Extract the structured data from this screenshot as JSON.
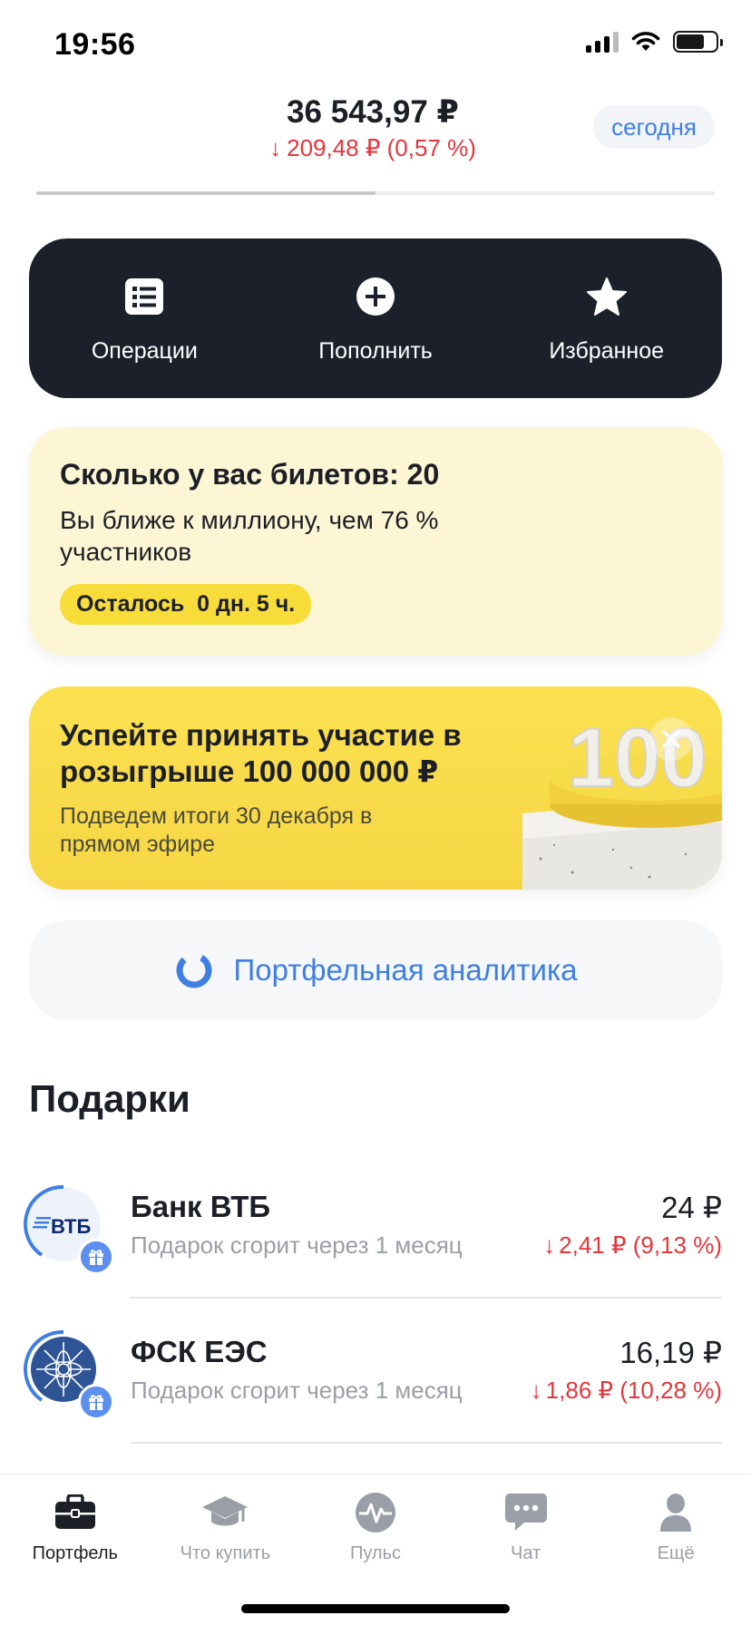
{
  "status_bar": {
    "time": "19:56",
    "battery_level": 0.72
  },
  "header": {
    "balance": "36 543,97 ₽",
    "change_arrow": "↓",
    "change": "209,48 ₽ (0,57 %)",
    "period": "сегодня",
    "progress": 0.5
  },
  "actions": [
    {
      "label": "Операции",
      "icon": "list-icon"
    },
    {
      "label": "Пополнить",
      "icon": "plus-circle-icon"
    },
    {
      "label": "Избранное",
      "icon": "star-icon"
    }
  ],
  "tickets": {
    "title": "Сколько у вас билетов: 20",
    "text": "Вы ближе к миллиону, чем 76 % участников",
    "badge": "Осталось  0 дн. 5 ч."
  },
  "promo": {
    "title": "Успейте принять участие в розыгрыше 100 000 000 ₽",
    "text": "Подведем итоги 30 декабря в прямом эфире",
    "art_text": "100"
  },
  "analytics": {
    "label": "Портфельная аналитика"
  },
  "gifts": {
    "title": "Подарки",
    "items": [
      {
        "name": "Банк ВТБ",
        "subtitle": "Подарок сгорит через 1 месяц",
        "value": "24 ₽",
        "change_arrow": "↓",
        "change": "2,41 ₽ (9,13 %)",
        "logo_text": "ВТБ",
        "ring_color": "#3e7fe4"
      },
      {
        "name": "ФСК ЕЭС",
        "subtitle": "Подарок сгорит через 1 месяц",
        "value": "16,19 ₽",
        "change_arrow": "↓",
        "change": "1,86 ₽ (10,28 %)",
        "logo_text": "",
        "ring_color": "#3e7fe4"
      }
    ]
  },
  "tabbar": {
    "tabs": [
      {
        "label": "Портфель",
        "icon": "briefcase-icon",
        "active": true
      },
      {
        "label": "Что купить",
        "icon": "graduation-cap-icon",
        "active": false
      },
      {
        "label": "Пульс",
        "icon": "pulse-icon",
        "active": false
      },
      {
        "label": "Чат",
        "icon": "chat-icon",
        "active": false
      },
      {
        "label": "Ещё",
        "icon": "profile-icon",
        "active": false
      }
    ]
  },
  "colors": {
    "accent": "#3e7fe4",
    "negative": "#e4363b",
    "dark_panel": "#1b202b",
    "promo_yellow": "#f7dc3a"
  }
}
